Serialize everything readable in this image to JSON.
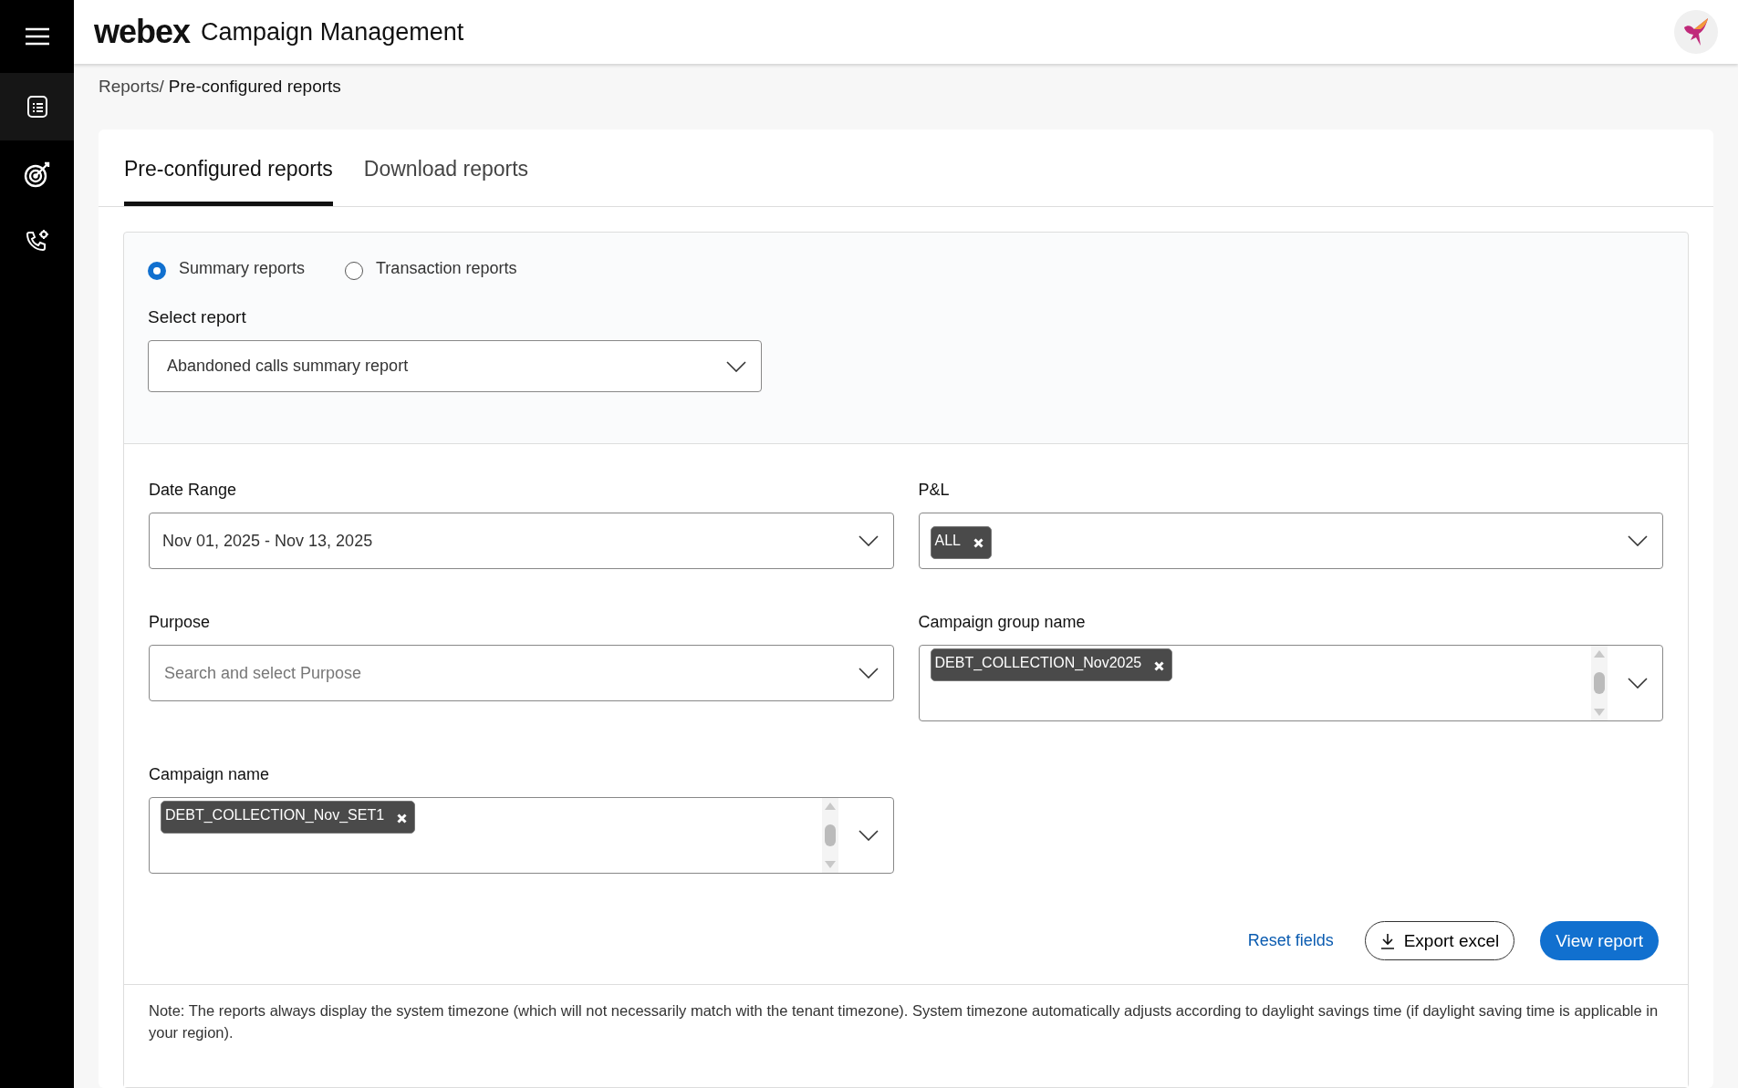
{
  "header": {
    "brand": "webex",
    "title": "Campaign Management"
  },
  "sidebar": {
    "items": [
      {
        "kind": "report",
        "selected": true
      },
      {
        "kind": "target",
        "selected": false
      },
      {
        "kind": "phone",
        "selected": false
      }
    ]
  },
  "breadcrumb": {
    "parent": "Reports/",
    "current": "Pre-configured reports"
  },
  "tabs": [
    {
      "label": "Pre-configured reports",
      "selected": true
    },
    {
      "label": "Download reports",
      "selected": false
    }
  ],
  "report_types": [
    {
      "label": "Summary reports",
      "selected": true
    },
    {
      "label": "Transaction reports",
      "selected": false
    }
  ],
  "select_report": {
    "label": "Select report",
    "value": "Abandoned calls summary report"
  },
  "fields": [
    {
      "label": "Date Range",
      "kind": "select",
      "value": "Nov 01, 2025 - Nov 13, 2025"
    },
    {
      "label": "P&L",
      "kind": "chips",
      "chips": [
        "ALL"
      ]
    },
    {
      "label": "Purpose",
      "kind": "search",
      "placeholder": "Search and select Purpose"
    },
    {
      "label": "Campaign group name",
      "kind": "chips_scroll",
      "chips": [
        "DEBT_COLLECTION_Nov2025"
      ]
    },
    {
      "label": "Campaign name",
      "kind": "chips_scroll",
      "chips": [
        "DEBT_COLLECTION_Nov_SET1"
      ]
    }
  ],
  "actions": {
    "reset": "Reset fields",
    "export": "Export excel",
    "view": "View report"
  },
  "note": "Note: The reports always display the system timezone (which will not necessarily match with the tenant timezone). System timezone automatically adjusts according to daylight savings time (if daylight saving time is applicable in your region)."
}
